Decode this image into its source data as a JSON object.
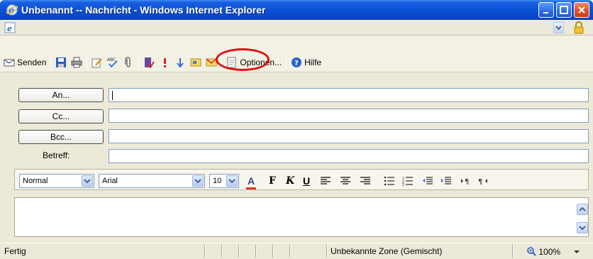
{
  "window": {
    "title": "Unbenannt -- Nachricht - Windows Internet Explorer"
  },
  "toolbar": {
    "send_label": "Senden",
    "options_label": "Optionen...",
    "help_label": "Hilfe",
    "icons": [
      "send-icon",
      "save-icon",
      "print-icon",
      "attach-file-icon",
      "spellcheck-icon",
      "paperclip-icon",
      "address-book-icon",
      "priority-high-icon",
      "priority-low-icon",
      "sign-icon",
      "encrypt-icon",
      "options-icon",
      "help-icon"
    ]
  },
  "form": {
    "to_button": "An...",
    "cc_button": "Cc...",
    "bcc_button": "Bcc...",
    "subject_label": "Betreff:",
    "to_value": "",
    "cc_value": "",
    "bcc_value": "",
    "subject_value": ""
  },
  "format": {
    "style": "Normal",
    "font": "Arial",
    "size": "10",
    "font_color_label": "A",
    "bold_label": "F",
    "italic_label": "K",
    "underline_label": "U"
  },
  "status": {
    "text": "Fertig",
    "zone": "Unbekannte Zone (Gemischt)",
    "zoom": "100%"
  },
  "colors": {
    "titlebar": "#0a52d8",
    "highlight_circle": "#e01010",
    "font_color_bar": "#e03a1a"
  }
}
